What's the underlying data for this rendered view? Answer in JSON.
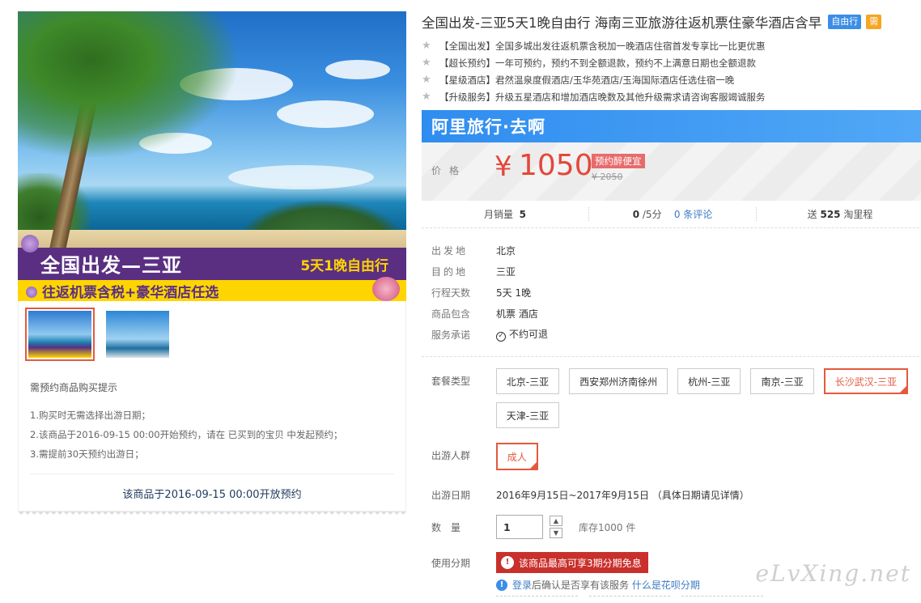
{
  "banner": {
    "line1": "全国出发—三亚",
    "line2": "5天1晚自由行",
    "line3": "往返机票含税+豪华酒店任选"
  },
  "notice": {
    "heading": "需预约商品购买提示",
    "items": [
      "1.购买时无需选择出游日期；",
      "2.该商品于2016-09-15 00:00开始预约，请在 已买到的宝贝 中发起预约；",
      "3.需提前30天预约出游日；"
    ],
    "open_text": "该商品于2016-09-15 00:00开放预约"
  },
  "title": {
    "text": "全国出发-三亚5天1晚自由行 海南三亚旅游往返机票住豪华酒店含早",
    "tag": "自由行",
    "tag2": "需"
  },
  "features": [
    "【全国出发】全国多城出发往返机票含税加一晚酒店住宿首发专享比一比更优惠",
    "【超长预约】一年可预约，预约不到全额退款，预约不上满意日期也全额退款",
    "【星级酒店】君然温泉度假酒店/玉华苑酒店/玉海国际酒店任选住宿一晚",
    "【升级服务】升级五星酒店和增加酒店晚数及其他升级需求请咨询客服竭诚服务"
  ],
  "brand": "阿里旅行·去啊",
  "price": {
    "label": "价格",
    "currency": "¥",
    "value": "1050",
    "badge": "预约醉便宜",
    "old": "¥ 2050"
  },
  "stats": {
    "sales_label": "月销量",
    "sales": "5",
    "rating": "0",
    "rating_unit": "/5分",
    "reviews": "0 条评论",
    "points_prefix": "送",
    "points": "525",
    "points_suffix": "淘里程"
  },
  "info": [
    {
      "k": "出发地",
      "v": "北京"
    },
    {
      "k": "目的地",
      "v": "三亚"
    },
    {
      "k": "行程天数",
      "v": "5天 1晚"
    },
    {
      "k": "商品包含",
      "v": "机票  酒店"
    },
    {
      "k": "服务承诺",
      "v": "不约可退"
    }
  ],
  "package": {
    "label": "套餐类型",
    "options": [
      "北京-三亚",
      "西安郑州济南徐州",
      "杭州-三亚",
      "南京-三亚",
      "长沙武汉-三亚",
      "天津-三亚"
    ]
  },
  "travelers": {
    "label": "出游人群",
    "option": "成人"
  },
  "date": {
    "label": "出游日期",
    "value": "2016年9月15日~2017年9月15日 （具体日期请见详情）"
  },
  "quantity": {
    "label": "数量",
    "value": "1",
    "stock": "库存1000 件"
  },
  "installment": {
    "label": "使用分期",
    "button": "该商品最高可享3期分期免息",
    "tip_login": "登录",
    "tip_mid": "后确认是否享有该服务",
    "tip_link": "什么是花呗分期"
  },
  "watermark": "eLvXing.net"
}
